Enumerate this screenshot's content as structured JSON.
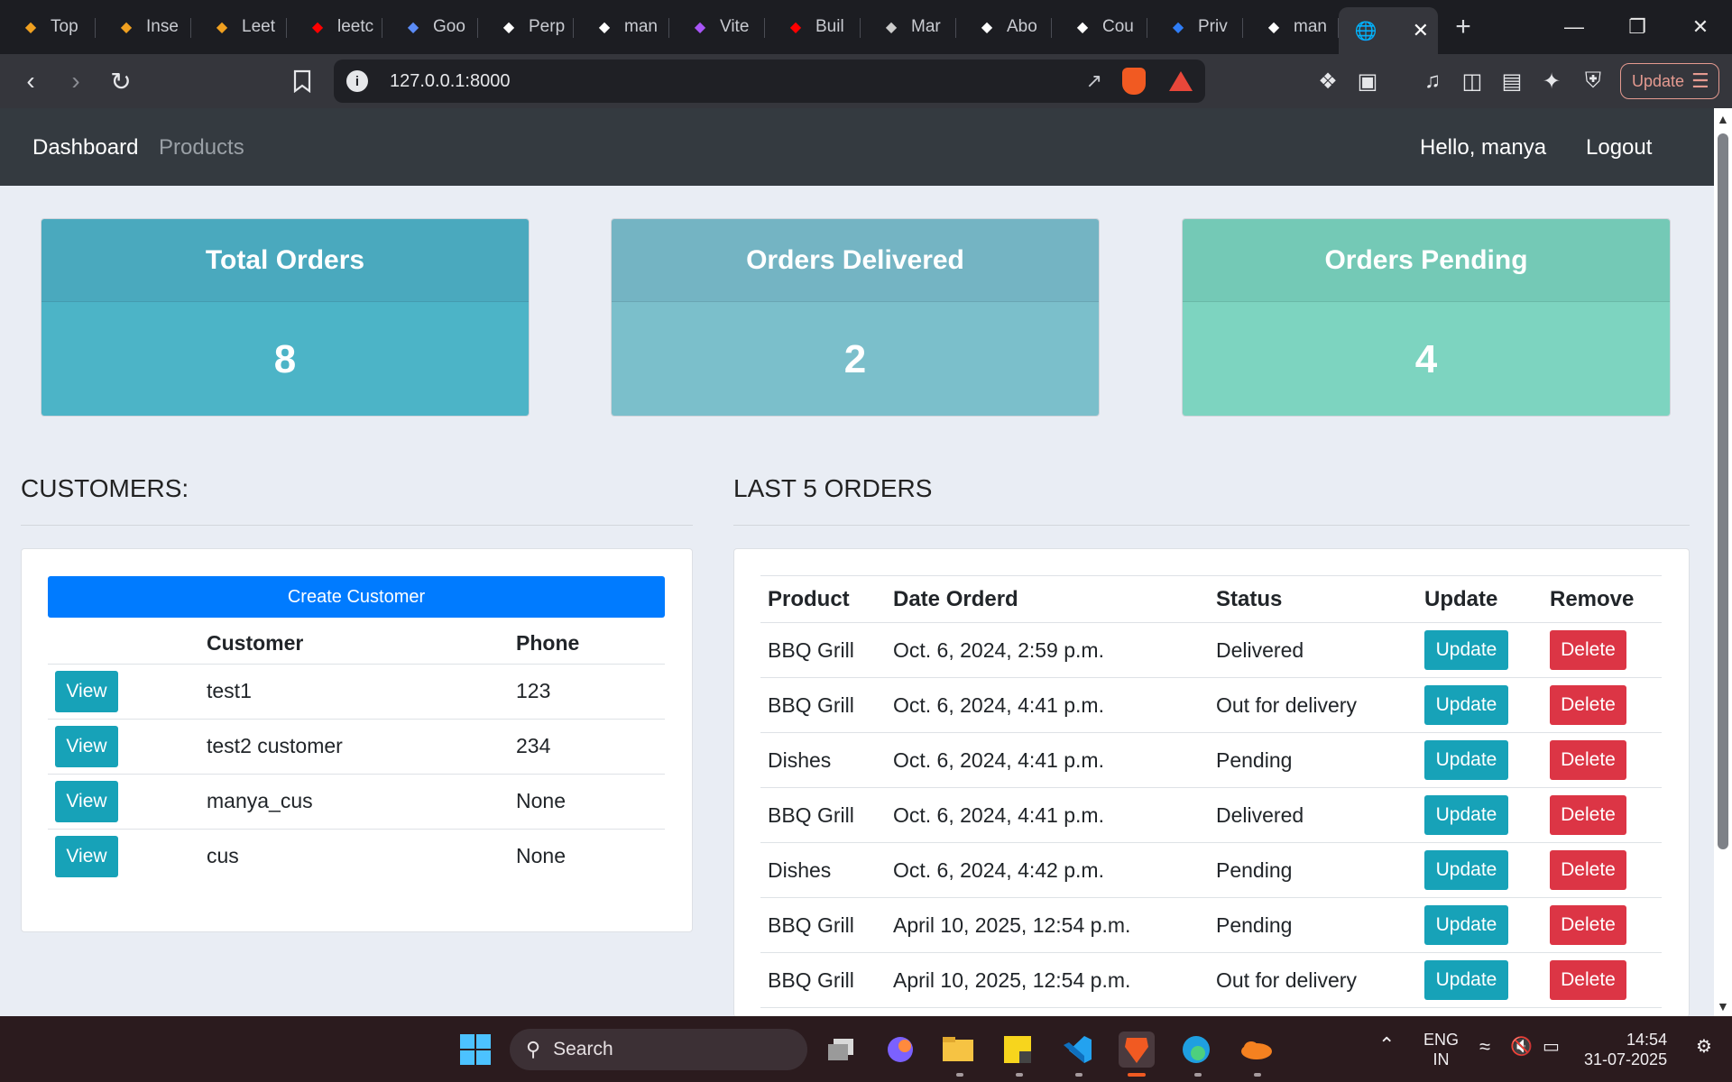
{
  "browser": {
    "tabs": [
      {
        "label": "Top",
        "icon": "leetcode-icon",
        "color": "#f0a020"
      },
      {
        "label": "Inse",
        "icon": "leetcode-icon",
        "color": "#f0a020"
      },
      {
        "label": "Leet",
        "icon": "leetcode-icon",
        "color": "#f0a020"
      },
      {
        "label": "leetc",
        "icon": "youtube-icon",
        "color": "#ff0000"
      },
      {
        "label": "Goo",
        "icon": "gemini-icon",
        "color": "#5b8cf7"
      },
      {
        "label": "Perp",
        "icon": "perplexity-icon",
        "color": "#ffffff"
      },
      {
        "label": "man",
        "icon": "triangle-icon",
        "color": "#ffffff"
      },
      {
        "label": "Vite",
        "icon": "vite-icon",
        "color": "#a855f7"
      },
      {
        "label": "Buil",
        "icon": "youtube-icon",
        "color": "#ff0000"
      },
      {
        "label": "Mar",
        "icon": "globe-icon",
        "color": "#cccccc"
      },
      {
        "label": "Abo",
        "icon": "openai-icon",
        "color": "#ffffff"
      },
      {
        "label": "Cou",
        "icon": "doc-icon",
        "color": "#ffffff"
      },
      {
        "label": "Priv",
        "icon": "s-logo-icon",
        "color": "#2f7df6"
      },
      {
        "label": "man",
        "icon": "github-icon",
        "color": "#ffffff"
      }
    ],
    "url": "127.0.0.1:8000",
    "update_label": "Update"
  },
  "nav": {
    "dashboard": "Dashboard",
    "products": "Products",
    "greeting": "Hello, manya",
    "logout": "Logout"
  },
  "stats": {
    "total": {
      "title": "Total Orders",
      "value": "8"
    },
    "delivered": {
      "title": "Orders Delivered",
      "value": "2"
    },
    "pending": {
      "title": "Orders Pending",
      "value": "4"
    }
  },
  "customers": {
    "heading": "CUSTOMERS:",
    "create_label": "Create Customer",
    "columns": [
      "",
      "Customer",
      "Phone"
    ],
    "view_label": "View",
    "rows": [
      {
        "name": "test1",
        "phone": "123"
      },
      {
        "name": "test2 customer",
        "phone": "234"
      },
      {
        "name": "manya_cus",
        "phone": "None"
      },
      {
        "name": "cus",
        "phone": "None"
      }
    ]
  },
  "orders": {
    "heading": "LAST 5 ORDERS",
    "columns": [
      "Product",
      "Date Orderd",
      "Status",
      "Update",
      "Remove"
    ],
    "update_label": "Update",
    "delete_label": "Delete",
    "rows": [
      {
        "product": "BBQ Grill",
        "date": "Oct. 6, 2024, 2:59 p.m.",
        "status": "Delivered"
      },
      {
        "product": "BBQ Grill",
        "date": "Oct. 6, 2024, 4:41 p.m.",
        "status": "Out for delivery"
      },
      {
        "product": "Dishes",
        "date": "Oct. 6, 2024, 4:41 p.m.",
        "status": "Pending"
      },
      {
        "product": "BBQ Grill",
        "date": "Oct. 6, 2024, 4:41 p.m.",
        "status": "Delivered"
      },
      {
        "product": "Dishes",
        "date": "Oct. 6, 2024, 4:42 p.m.",
        "status": "Pending"
      },
      {
        "product": "BBQ Grill",
        "date": "April 10, 2025, 12:54 p.m.",
        "status": "Pending"
      },
      {
        "product": "BBQ Grill",
        "date": "April 10, 2025, 12:54 p.m.",
        "status": "Out for delivery"
      }
    ]
  },
  "taskbar": {
    "search_placeholder": "Search",
    "lang_top": "ENG",
    "lang_bottom": "IN",
    "time": "14:54",
    "date": "31-07-2025"
  }
}
